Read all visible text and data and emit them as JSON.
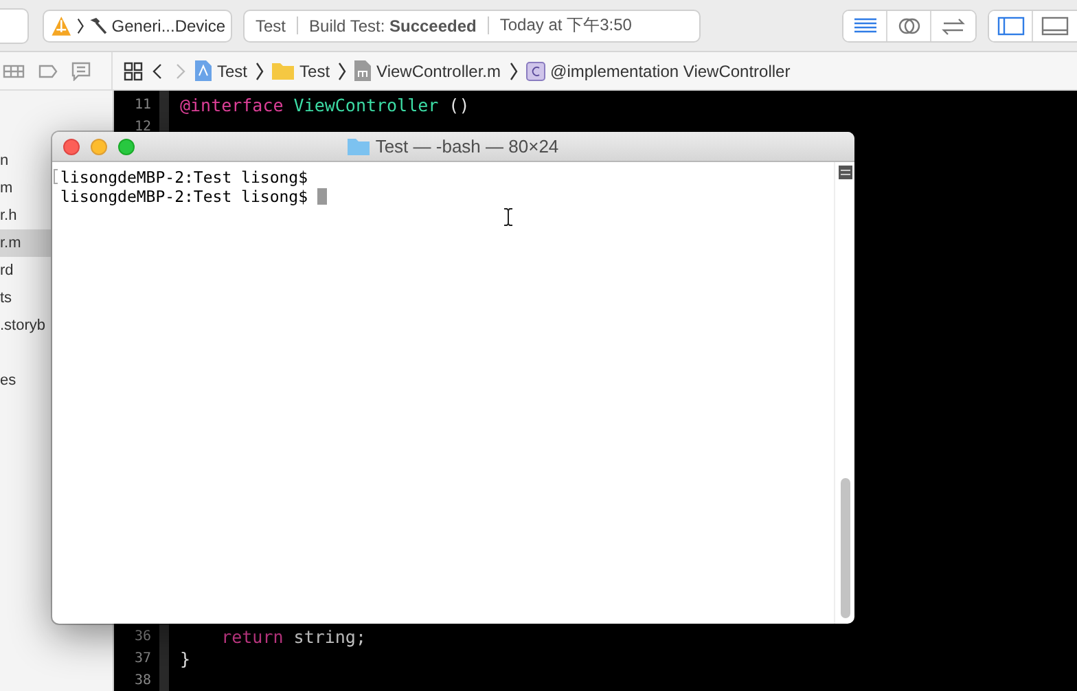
{
  "toolbar": {
    "scheme": {
      "destination": "Generi...Device"
    },
    "activity": {
      "project": "Test",
      "status": "Build Test: **Succeeded**",
      "time": "Today at 下午3:50"
    },
    "editor_modes": [
      {
        "kind": "standard",
        "selected": true
      },
      {
        "kind": "assistant",
        "selected": false
      },
      {
        "kind": "version",
        "selected": false
      }
    ],
    "panels": [
      {
        "kind": "navigator",
        "selected": true
      },
      {
        "kind": "debug",
        "selected": false
      }
    ]
  },
  "jump_bar": {
    "crumbs": [
      {
        "kind": "project",
        "label": "Test"
      },
      {
        "kind": "folder",
        "label": "Test"
      },
      {
        "kind": "mfile",
        "label": "ViewController.m"
      },
      {
        "kind": "class",
        "label": "@implementation ViewController"
      }
    ]
  },
  "navigator": {
    "items": [
      {
        "label": "n",
        "selected": false
      },
      {
        "label": "m",
        "selected": false
      },
      {
        "label": "r.h",
        "selected": false
      },
      {
        "label": "r.m",
        "selected": true
      },
      {
        "label": "rd",
        "selected": false
      },
      {
        "label": "ts",
        "selected": false
      },
      {
        "label": ".storyb",
        "selected": false
      },
      {
        "label": "es",
        "selected": false,
        "group_start": true
      }
    ]
  },
  "editor": {
    "top_lines": [
      {
        "number": "11",
        "tokens": [
          {
            "kind": "keyword",
            "text": "@interface"
          },
          {
            "kind": "class",
            "text": " ViewController"
          },
          {
            "kind": "plain",
            "text": " ()"
          }
        ]
      },
      {
        "number": "12"
      }
    ],
    "bottom_lines": [
      {
        "number": "36",
        "tokens": [
          {
            "kind": "keyword",
            "text": "    return"
          },
          {
            "kind": "plain",
            "text": " string;"
          }
        ]
      },
      {
        "number": "37",
        "tokens": [
          {
            "kind": "plain",
            "text": "}"
          }
        ]
      },
      {
        "number": "38"
      }
    ]
  },
  "terminal": {
    "title": "Test — -bash — 80×24",
    "lines": [
      {
        "text": "lisongdeMBP-2:Test lisong$",
        "marked": true,
        "cursor": false
      },
      {
        "text": "lisongdeMBP-2:Test lisong$",
        "marked": false,
        "cursor": true
      }
    ]
  }
}
